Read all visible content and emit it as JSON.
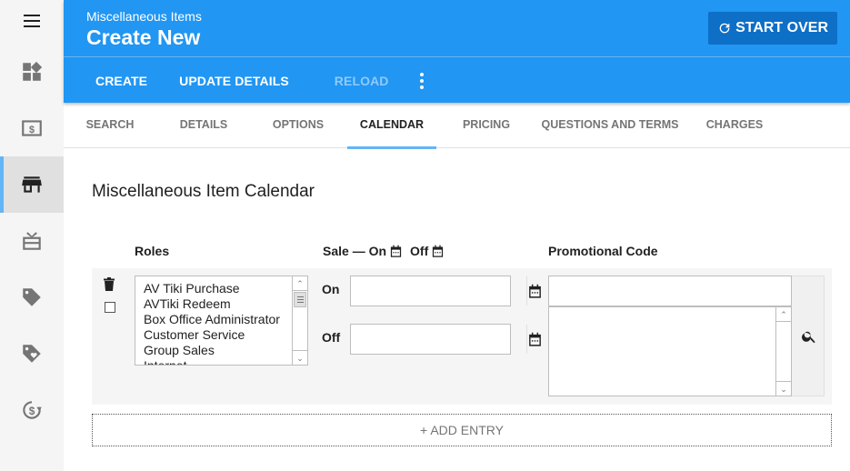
{
  "sidebar": {
    "items": [
      {
        "icon": "menu-icon"
      },
      {
        "icon": "widgets-icon"
      },
      {
        "icon": "money-icon"
      },
      {
        "icon": "store-icon",
        "active": true
      },
      {
        "icon": "gift-card-icon"
      },
      {
        "icon": "tag-icon"
      },
      {
        "icon": "tag-heart-icon"
      },
      {
        "icon": "currency-exchange-icon"
      }
    ]
  },
  "header": {
    "subtitle": "Miscellaneous Items",
    "title": "Create New",
    "start_over_label": "START OVER",
    "actions": {
      "create": "CREATE",
      "update_details": "UPDATE DETAILS",
      "reload": "RELOAD"
    }
  },
  "tabs": [
    {
      "label": "SEARCH"
    },
    {
      "label": "DETAILS"
    },
    {
      "label": "OPTIONS"
    },
    {
      "label": "CALENDAR",
      "active": true
    },
    {
      "label": "PRICING"
    },
    {
      "label": "QUESTIONS AND TERMS"
    },
    {
      "label": "CHARGES"
    }
  ],
  "section": {
    "title": "Miscellaneous Item Calendar",
    "columns": {
      "roles": "Roles",
      "sale_prefix": "Sale — On",
      "sale_off": "Off",
      "promo": "Promotional Code"
    }
  },
  "entry": {
    "roles": [
      "AV Tiki Purchase",
      "AVTiki Redeem",
      "Box Office Administrator",
      "Customer Service",
      "Group Sales",
      "Internet"
    ],
    "on_label": "On",
    "off_label": "Off",
    "on_value": "",
    "off_value": "",
    "promo_value": ""
  },
  "add_entry_label": "+ ADD ENTRY"
}
